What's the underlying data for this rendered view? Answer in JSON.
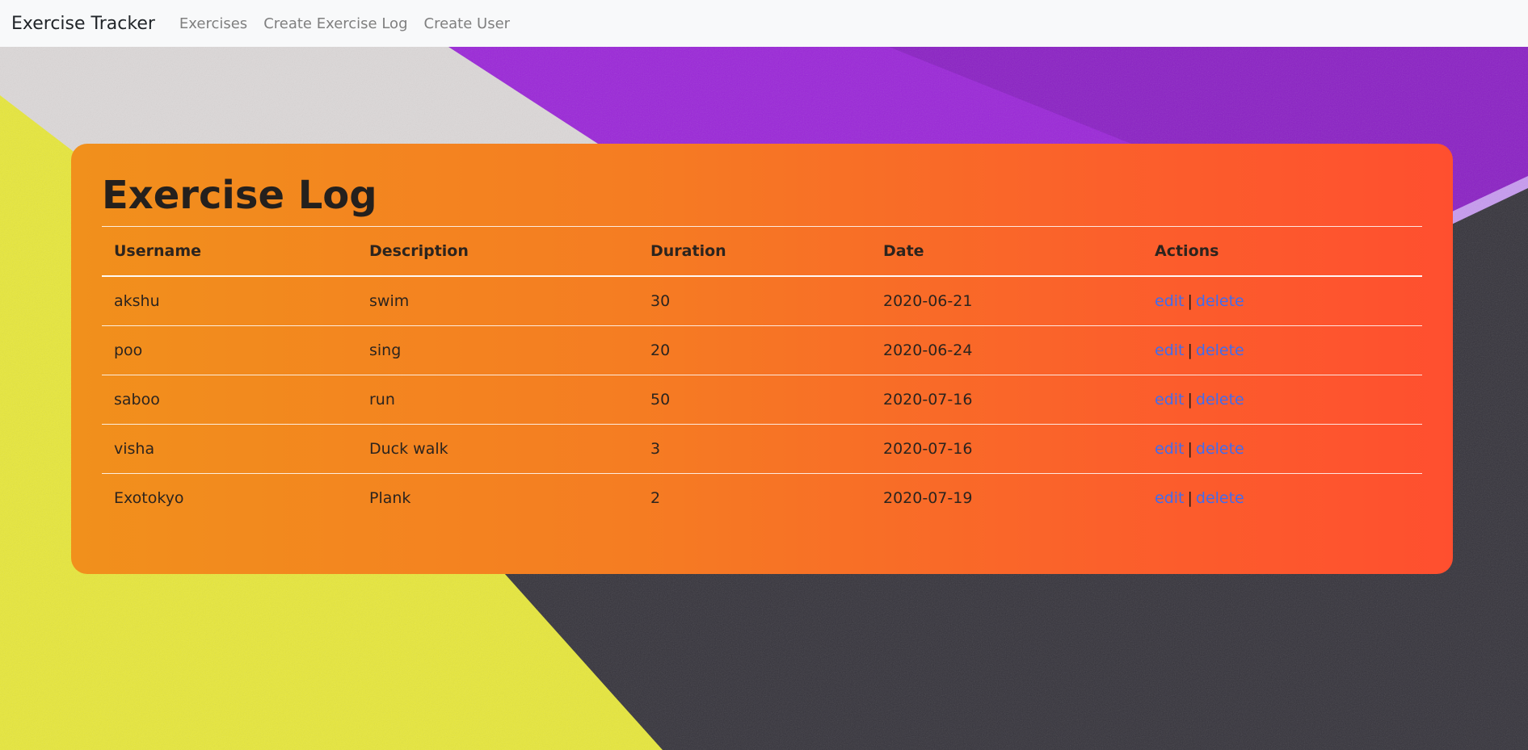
{
  "navbar": {
    "brand": "Exercise Tracker",
    "links": [
      "Exercises",
      "Create Exercise Log",
      "Create User"
    ]
  },
  "page": {
    "title": "Exercise Log"
  },
  "table": {
    "headers": [
      "Username",
      "Description",
      "Duration",
      "Date",
      "Actions"
    ],
    "rows": [
      {
        "username": "akshu",
        "description": "swim",
        "duration": "30",
        "date": "2020-06-21"
      },
      {
        "username": "poo",
        "description": "sing",
        "duration": "20",
        "date": "2020-06-24"
      },
      {
        "username": "saboo",
        "description": "run",
        "duration": "50",
        "date": "2020-07-16"
      },
      {
        "username": "visha",
        "description": "Duck walk",
        "duration": "3",
        "date": "2020-07-16"
      },
      {
        "username": "Exotokyo",
        "description": "Plank",
        "duration": "2",
        "date": "2020-07-19"
      }
    ],
    "edit_label": "edit",
    "separator": "|",
    "delete_label": "delete"
  },
  "colors": {
    "card_gradient_start": "#f1901c",
    "card_gradient_end": "#ff4f2f",
    "link": "#3f6cf0",
    "navbar_bg": "#f8f9fa"
  }
}
